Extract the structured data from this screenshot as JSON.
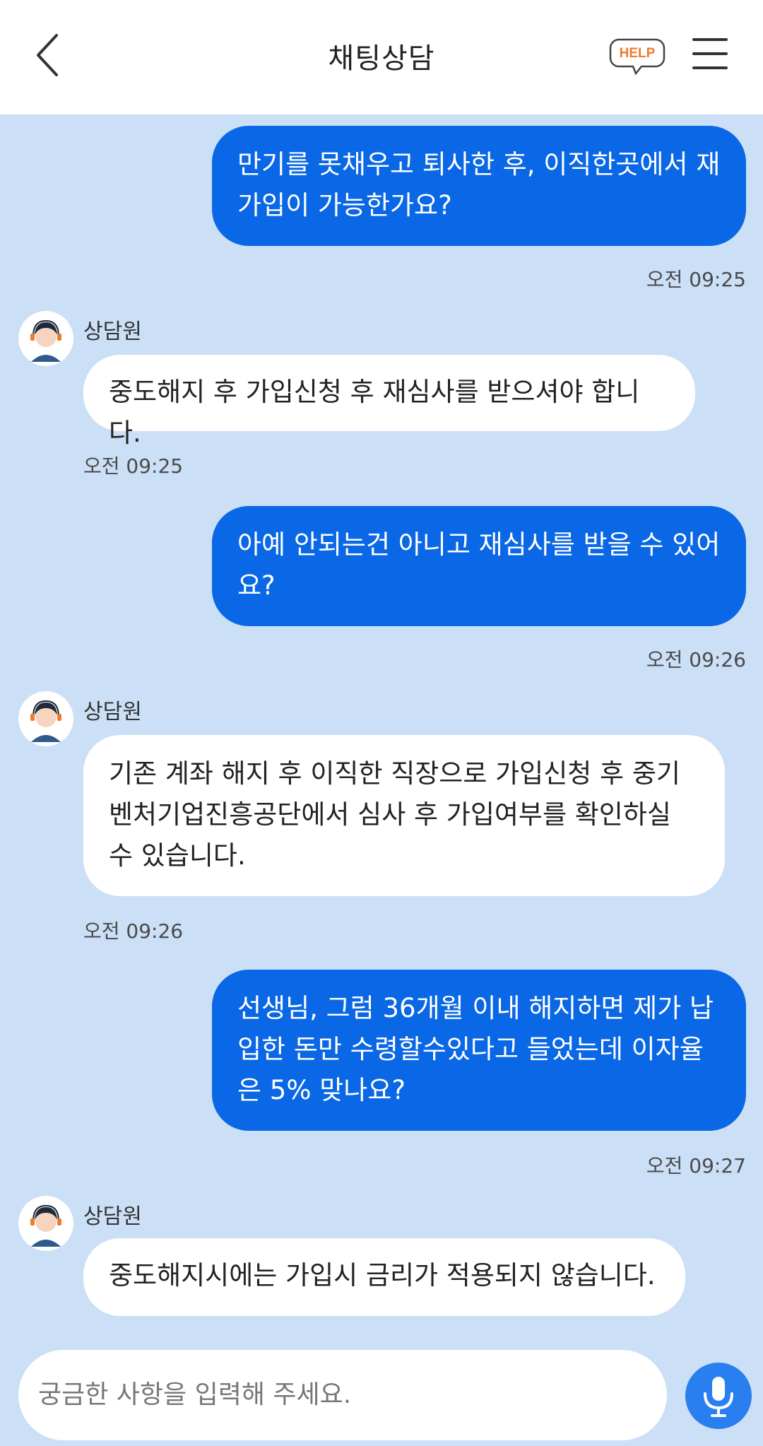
{
  "header": {
    "title": "채팅상담",
    "help_label": "HELP",
    "back_icon": "chevron-left-icon",
    "menu_icon": "hamburger-menu-icon"
  },
  "messages": [
    {
      "from": "user",
      "text": "만기를 못채우고 퇴사한 후, 이직한곳에서 재\n가입이 가능한가요?",
      "time": "오전 09:25"
    },
    {
      "from": "agent",
      "name": "상담원",
      "text": "중도해지 후 가입신청 후 재심사를 받으셔야 합니다.",
      "time": "오전 09:25"
    },
    {
      "from": "user",
      "text": "아예 안되는건 아니고 재심사를 받을 수 있어\n요?",
      "time": "오전 09:26"
    },
    {
      "from": "agent",
      "name": "상담원",
      "text": "기존 계좌 해지 후 이직한 직장으로 가입신청 후 중기\n벤처기업진흥공단에서 심사 후 가입여부를 확인하실\n수 있습니다.",
      "time": "오전 09:26"
    },
    {
      "from": "user",
      "text": "선생님, 그럼 36개월 이내 해지하면 제가 납\n입한 돈만 수령할수있다고 들었는데 이자율\n은 5% 맞나요?",
      "time": "오전 09:27"
    },
    {
      "from": "agent",
      "name": "상담원",
      "text": "중도해지시에는 가입시 금리가 적용되지 않습니다."
    }
  ],
  "input": {
    "placeholder": "궁금한 사항을 입력해 주세요.",
    "mic_icon": "microphone-icon"
  },
  "colors": {
    "background": "#cbdff6",
    "user_bubble": "#0a67e5",
    "agent_bubble": "#ffffff",
    "help_accent": "#f07b2c",
    "mic_button": "#2a7ff0"
  }
}
